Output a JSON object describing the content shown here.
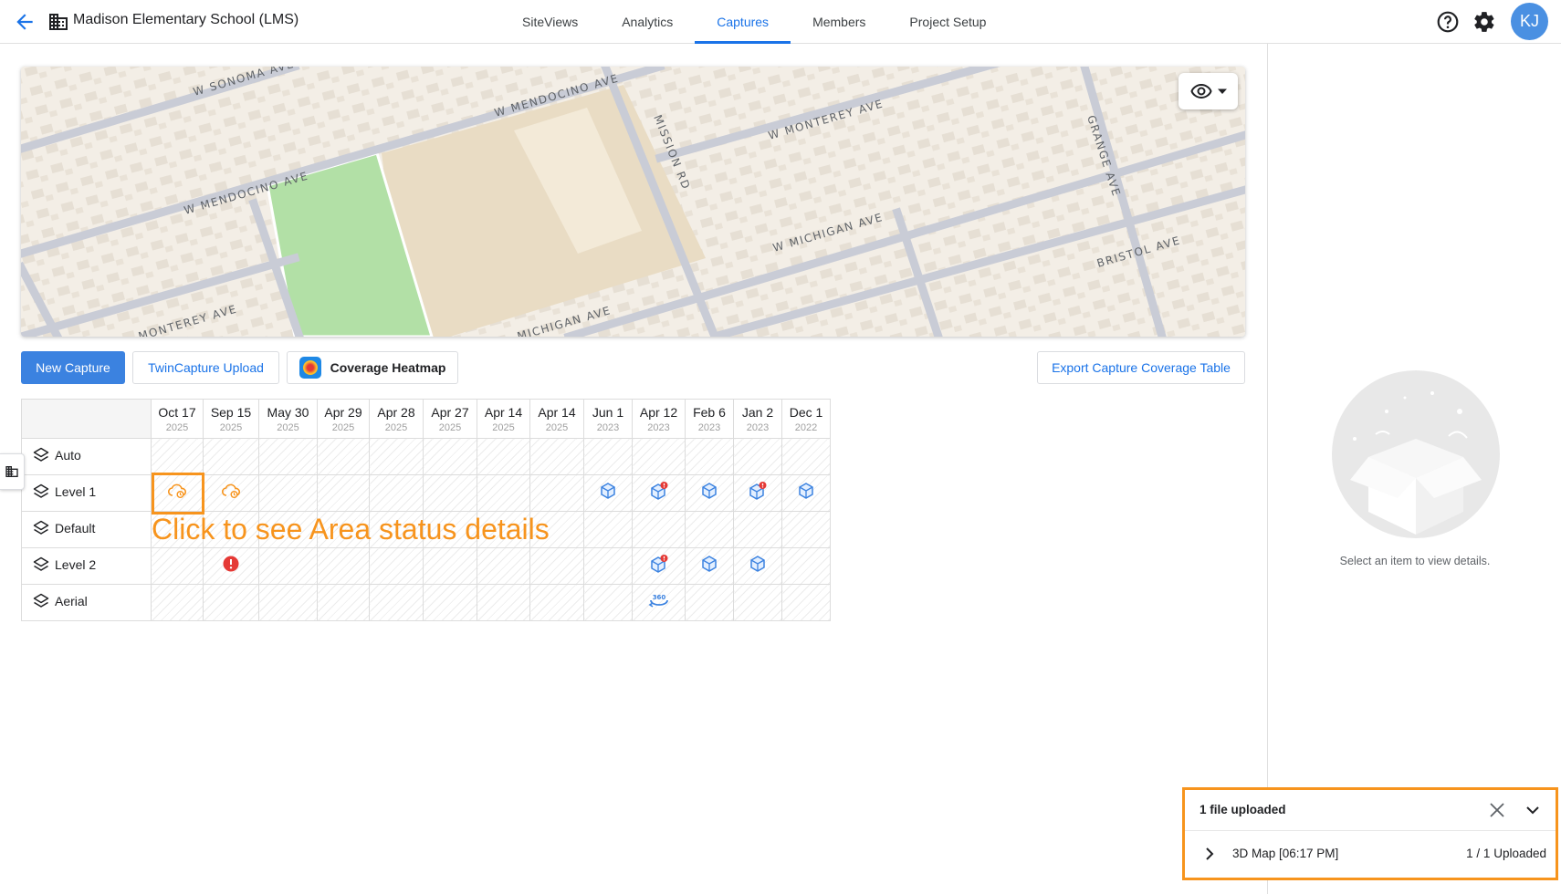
{
  "header": {
    "title": "Madison Elementary School (LMS)",
    "tabs": [
      {
        "label": "SiteViews",
        "active": false
      },
      {
        "label": "Analytics",
        "active": false
      },
      {
        "label": "Captures",
        "active": true
      },
      {
        "label": "Members",
        "active": false
      },
      {
        "label": "Project Setup",
        "active": false
      }
    ],
    "avatar_initials": "KJ",
    "accent_color": "#1a73e8"
  },
  "map": {
    "street_labels": [
      "W SONOMA AVE",
      "W MENDOCINO AVE",
      "W MONTEREY AVE",
      "W MENDOCINO AVE",
      "MISSION RD",
      "GRANGE AVE",
      "W MICHIGAN AVE",
      "BRISTOL AVE",
      "MONTEREY AVE",
      "MICHIGAN AVE"
    ],
    "view_icon": "eye-icon"
  },
  "toolbar": {
    "new_capture": "New Capture",
    "twincapture_upload": "TwinCapture Upload",
    "coverage_heatmap": "Coverage Heatmap",
    "export": "Export Capture Coverage Table"
  },
  "grid": {
    "columns": [
      {
        "date": "Oct 17",
        "year": "2025"
      },
      {
        "date": "Sep 15",
        "year": "2025"
      },
      {
        "date": "May 30",
        "year": "2025"
      },
      {
        "date": "Apr 29",
        "year": "2025"
      },
      {
        "date": "Apr 28",
        "year": "2025"
      },
      {
        "date": "Apr 27",
        "year": "2025"
      },
      {
        "date": "Apr 14",
        "year": "2025"
      },
      {
        "date": "Apr 14",
        "year": "2025"
      },
      {
        "date": "Jun 1",
        "year": "2023"
      },
      {
        "date": "Apr 12",
        "year": "2023"
      },
      {
        "date": "Feb 6",
        "year": "2023"
      },
      {
        "date": "Jan 2",
        "year": "2023"
      },
      {
        "date": "Dec 1",
        "year": "2022"
      }
    ],
    "rows": [
      {
        "label": "Auto",
        "cells": [
          "",
          "",
          "",
          "",
          "",
          "",
          "",
          "",
          "",
          "",
          "",
          "",
          ""
        ]
      },
      {
        "label": "Level 1",
        "cells": [
          "cloud-processing",
          "cloud-processing",
          "",
          "",
          "",
          "",
          "",
          "",
          "cube",
          "cube-alert",
          "cube",
          "cube-alert",
          "cube"
        ]
      },
      {
        "label": "Default",
        "cells": [
          "",
          "",
          "",
          "",
          "",
          "",
          "",
          "",
          "",
          "",
          "",
          "",
          ""
        ]
      },
      {
        "label": "Level 2",
        "cells": [
          "",
          "error",
          "",
          "",
          "",
          "",
          "",
          "",
          "",
          "cube-alert",
          "cube",
          "cube",
          ""
        ]
      },
      {
        "label": "Aerial",
        "cells": [
          "",
          "",
          "",
          "",
          "",
          "",
          "",
          "",
          "",
          "360",
          "",
          "",
          ""
        ]
      }
    ]
  },
  "annotation": {
    "text": "Click to see Area status details",
    "color": "#f7941d"
  },
  "detail_panel": {
    "empty_text": "Select an item to view details."
  },
  "upload": {
    "title": "1 file uploaded",
    "item_name": "3D Map [06:17 PM]",
    "item_status": "1 / 1 Uploaded"
  }
}
